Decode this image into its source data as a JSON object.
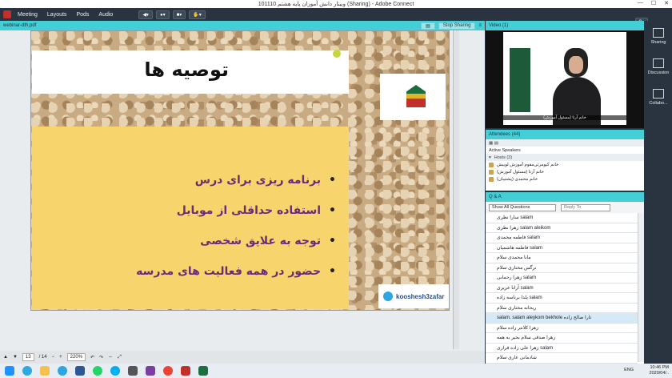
{
  "window": {
    "title": "وبینار دانش آموزان پایه هشتم 101110 (Sharing) - Adobe Connect",
    "controls": [
      "—",
      "☐",
      "✕"
    ]
  },
  "menu": {
    "items": [
      "Meeting",
      "Layouts",
      "Pods",
      "Audio"
    ]
  },
  "share": {
    "filename": "webinar-dth.pdf",
    "stop_label": "Stop Sharing",
    "slide": {
      "title": "توصیه ها",
      "bullets": [
        "برنامه ریزی برای درس",
        "استفاده حداقلی از موبایل",
        "توجه به علایق شخصی",
        "حضور در همه فعالیت های مدرسه"
      ],
      "telegram_handle": "kooshesh3zafar"
    },
    "page_current": "13",
    "page_total": "/ 14",
    "zoom": "220%"
  },
  "video": {
    "header": "Video (1)",
    "caption": "خانم آرتا (مسئول آموزش)"
  },
  "attendees": {
    "header": "Attendees (44)",
    "active_speakers": "Active Speakers",
    "hosts_label": "Hosts (3)",
    "hosts": [
      "خانم کیومرثی‌مقوم آموزش لوبیش",
      "خانم آرتا (مسئول آموزش)",
      "خانم محمدی (پشتیبان)"
    ]
  },
  "qa": {
    "header": "Q & A",
    "filter_label": "Show All Questions",
    "reply_label": "Reply To",
    "questions": [
      "سارا نظری salam",
      "زهرا نظری salam aleikom",
      "فاطمه محمدی salam",
      "فاطمه هاشمیان salam",
      "مانا محمدی سلام",
      "نرگس مختاری سلام",
      "زهرا رحمانی salam",
      "آرانا عزیزی salam",
      "یلدا برناسه زاده salam",
      "ریحانه مختاری سلام",
      "salam. salam aleykom bekhole تارا صالح زاده",
      "زهرا کلانتر زاده سلام",
      "زهرا صدقی سلام بخیر به همه",
      "زهرا علی زاده قراری salam",
      "شادمانی عاری سلام"
    ]
  },
  "rail": {
    "items": [
      "Sharing",
      "Discussion",
      "Collabo..."
    ]
  },
  "tray": {
    "time": "10:46 PM",
    "date": "2020/04/..",
    "lang": "ENG"
  }
}
